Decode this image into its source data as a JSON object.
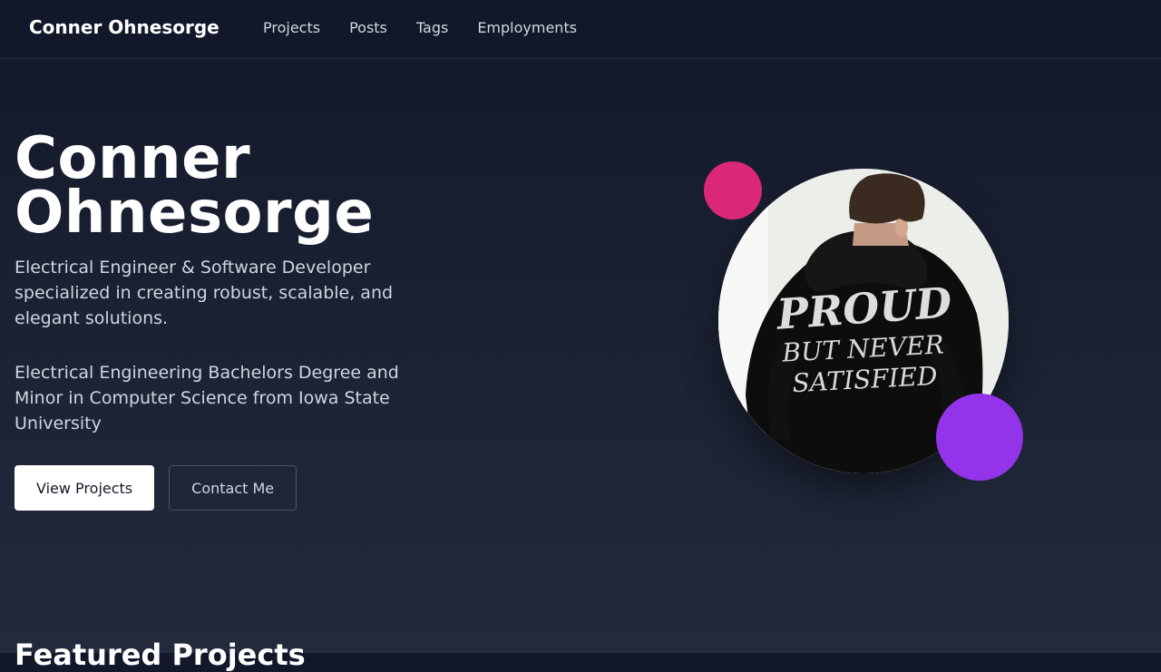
{
  "nav": {
    "brand": "Conner Ohnesorge",
    "links": [
      "Projects",
      "Posts",
      "Tags",
      "Employments"
    ]
  },
  "hero": {
    "title_line1": "Conner",
    "title_line2": "Ohnesorge",
    "subtitle": "Electrical Engineer & Software Developer specialized in creating robust, scalable, and elegant solutions.",
    "education": "Electrical Engineering Bachelors Degree and Minor in Computer Science from Iowa State University",
    "primary_button": "View Projects",
    "secondary_button": "Contact Me",
    "photo_text_line1": "PROUD",
    "photo_text_line2": "BUT NEVER",
    "photo_text_line3": "SATISFIED"
  },
  "sections": {
    "featured_title": "Featured Projects"
  },
  "colors": {
    "accent_pink": "#db2777",
    "accent_purple": "#9333ea",
    "background": "#121829"
  }
}
